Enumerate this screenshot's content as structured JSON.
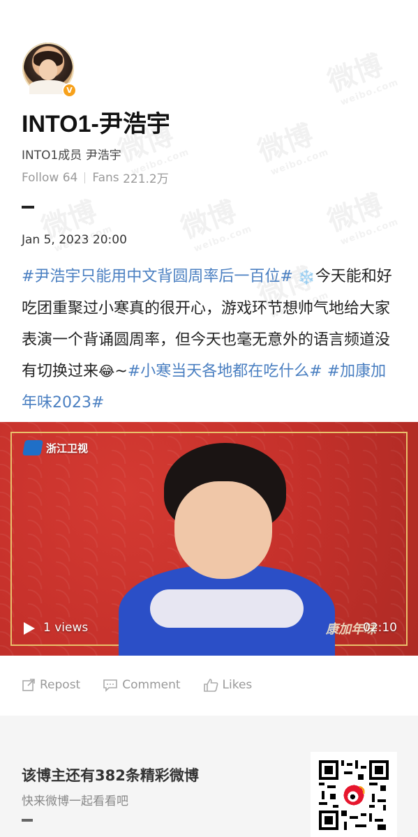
{
  "profile": {
    "name": "INTO1-尹浩宇",
    "bio": "INTO1成员 尹浩宇",
    "follow_label": "Follow",
    "follow_count": "64",
    "fans_label": "Fans",
    "fans_count": "221.2万"
  },
  "post": {
    "date": "Jan 5, 2023 20:00",
    "tag1": "#尹浩宇只能用中文背圆周率后一百位#",
    "text1": "今天能和好吃团重聚过小寒真的很开心，游戏环节想帅气地给大家表演一个背诵圆周率，但今天也毫无意外的语言频道没有切换过来",
    "text2": "~",
    "tag2": "#小寒当天各地都在吃什么#",
    "tag3": "#加康加年味2023#"
  },
  "video": {
    "channel_logo_text": "浙江卫视",
    "views": "1 views",
    "duration": "02:10",
    "show_logo": "康加年味"
  },
  "actions": {
    "repost": "Repost",
    "comment": "Comment",
    "likes": "Likes"
  },
  "footer": {
    "title": "该博主还有382条精彩微博",
    "subtitle": "快来微博一起看看吧"
  },
  "watermark": {
    "text": "微博",
    "subtext": "weibo.com"
  },
  "colors": {
    "hashtag": "#4a7fc1",
    "verified_badge": "#f7a11b",
    "video_bg": "#c6312b"
  },
  "icons": [
    "verified-icon",
    "snowflake-icon",
    "laugh-cry-emoji-icon",
    "play-icon",
    "repost-icon",
    "comment-icon",
    "like-icon",
    "qr-code"
  ]
}
